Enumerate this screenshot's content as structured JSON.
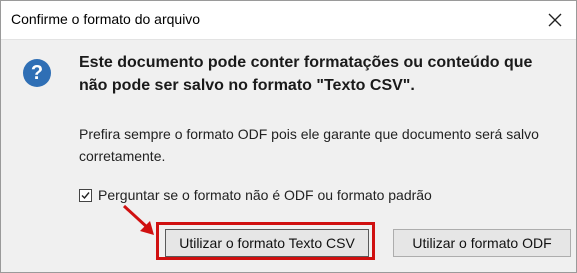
{
  "dialog": {
    "title": "Confirme o formato do arquivo",
    "headline": "Este documento pode conter formatações ou conteúdo que não pode ser salvo no formato \"Texto CSV\".",
    "body": "Prefira sempre o formato ODF pois ele garante que documento será salvo corretamente.",
    "checkbox": {
      "label": "Perguntar se o formato não é ODF ou formato padrão",
      "checked": true
    },
    "buttons": {
      "keep_csv": "Utilizar o formato Texto CSV",
      "use_odf": "Utilizar o formato ODF"
    }
  },
  "colors": {
    "annotation": "#d01010",
    "question_icon": "#2f6fb5"
  },
  "icons": {
    "close": "close-icon",
    "question": "question-icon",
    "check": "checkmark-icon",
    "arrow": "arrow-icon"
  }
}
